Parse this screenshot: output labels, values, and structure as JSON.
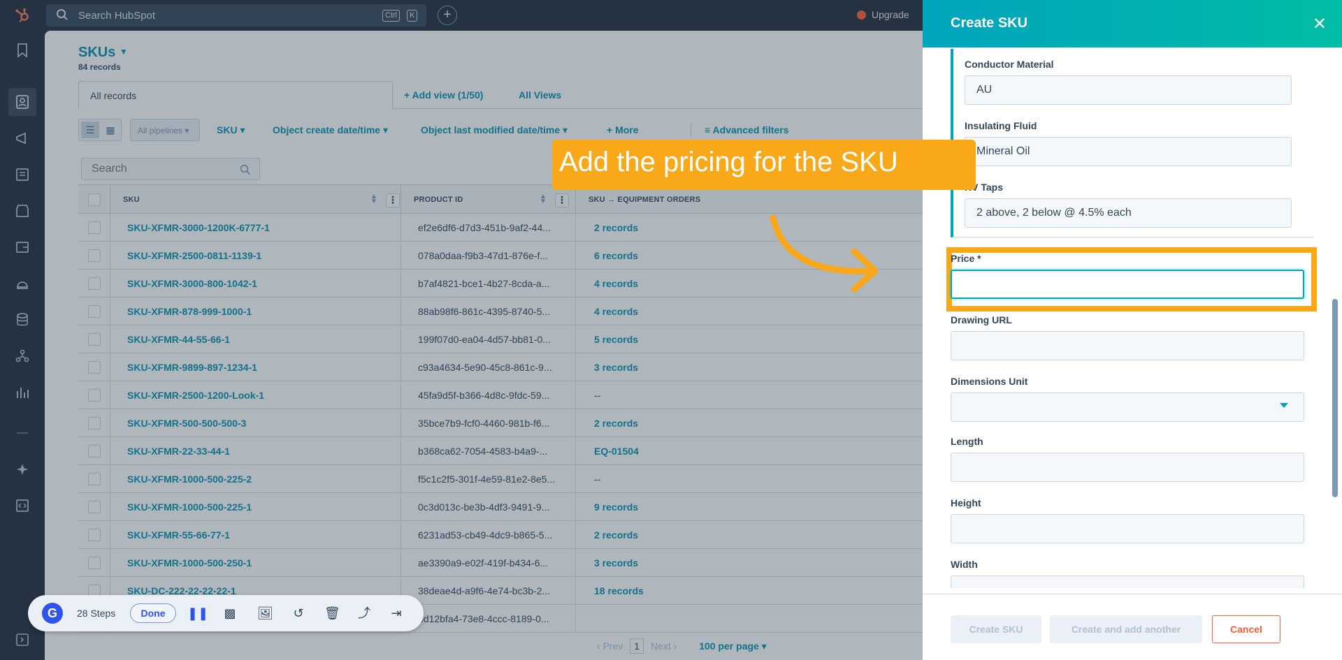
{
  "topbar": {
    "search_placeholder": "Search HubSpot",
    "kbd_ctrl": "Ctrl",
    "kbd_k": "K",
    "upgrade_label": "Upgrade"
  },
  "header": {
    "object_title": "SKUs",
    "record_count": "84 records"
  },
  "tabs": {
    "active": "All records",
    "add_view": "+ Add view (1/50)",
    "all_views": "All Views"
  },
  "filters": {
    "pipelines": "All pipelines",
    "sku": "SKU",
    "create_date": "Object create date/time",
    "modified_date": "Object last modified date/time",
    "more": "+ More",
    "advanced": "Advanced filters"
  },
  "table": {
    "search_placeholder": "Search",
    "columns": [
      "SKU",
      "PRODUCT ID",
      "SKU → EQUIPMENT ORDERS"
    ],
    "rows": [
      {
        "sku": "SKU-XFMR-3000-1200K-6777-1",
        "pid": "ef2e6df6-d7d3-451b-9af2-44...",
        "orders": "2 records"
      },
      {
        "sku": "SKU-XFMR-2500-0811-1139-1",
        "pid": "078a0daa-f9b3-47d1-876e-f...",
        "orders": "6 records"
      },
      {
        "sku": "SKU-XFMR-3000-800-1042-1",
        "pid": "b7af4821-bce1-4b27-8cda-a...",
        "orders": "4 records"
      },
      {
        "sku": "SKU-XFMR-878-999-1000-1",
        "pid": "88ab98f6-861c-4395-8740-5...",
        "orders": "4 records"
      },
      {
        "sku": "SKU-XFMR-44-55-66-1",
        "pid": "199f07d0-ea04-4d57-bb81-0...",
        "orders": "5 records"
      },
      {
        "sku": "SKU-XFMR-9899-897-1234-1",
        "pid": "c93a4634-5e90-45c8-861c-9...",
        "orders": "3 records"
      },
      {
        "sku": "SKU-XFMR-2500-1200-Look-1",
        "pid": "45fa9d5f-b366-4d8c-9fdc-59...",
        "orders": "--"
      },
      {
        "sku": "SKU-XFMR-500-500-500-3",
        "pid": "35bce7b9-fcf0-4460-981b-f6...",
        "orders": "2 records"
      },
      {
        "sku": "SKU-XFMR-22-33-44-1",
        "pid": "b368ca62-7054-4583-b4a9-...",
        "orders": "EQ-01504"
      },
      {
        "sku": "SKU-XFMR-1000-500-225-2",
        "pid": "f5c1c2f5-301f-4e59-81e2-8e5...",
        "orders": "--"
      },
      {
        "sku": "SKU-XFMR-1000-500-225-1",
        "pid": "0c3d013c-be3b-4df3-9491-9...",
        "orders": "9 records"
      },
      {
        "sku": "SKU-XFMR-55-66-77-1",
        "pid": "6231ad53-cb49-4dc9-b865-5...",
        "orders": "2 records"
      },
      {
        "sku": "SKU-XFMR-1000-500-250-1",
        "pid": "ae3390a9-e02f-419f-b434-6...",
        "orders": "3 records"
      },
      {
        "sku": "SKU-DC-222-22-22-22-1",
        "pid": "38deae4d-a9f6-4e74-bc3b-2...",
        "orders": "18 records"
      },
      {
        "sku": "",
        "pid": "ed12bfa4-73e8-4ccc-8189-0...",
        "orders": ""
      }
    ]
  },
  "pager": {
    "prev": "Prev",
    "page": "1",
    "next": "Next",
    "per_page": "100 per page"
  },
  "guide": {
    "logo": "G",
    "steps": "28 Steps",
    "done": "Done"
  },
  "drawer": {
    "title": "Create SKU",
    "conductor_label": "Conductor Material",
    "conductor_value": "AU",
    "fluid_label": "Insulating Fluid",
    "fluid_value": "Mineral Oil",
    "taps_label": "HV Taps",
    "taps_value": "2 above, 2 below @ 4.5% each",
    "price_label": "Price *",
    "drawing_label": "Drawing URL",
    "dim_unit_label": "Dimensions Unit",
    "length_label": "Length",
    "height_label": "Height",
    "width_label": "Width",
    "create_btn": "Create SKU",
    "create_another_btn": "Create and add another",
    "cancel_btn": "Cancel"
  },
  "callout": {
    "text": "Add the pricing for the SKU"
  },
  "colors": {
    "accent": "#00a4bd",
    "link": "#0091ae",
    "highlight": "#f9a81a",
    "danger": "#ff5c35",
    "nav": "#1f2b3a"
  }
}
